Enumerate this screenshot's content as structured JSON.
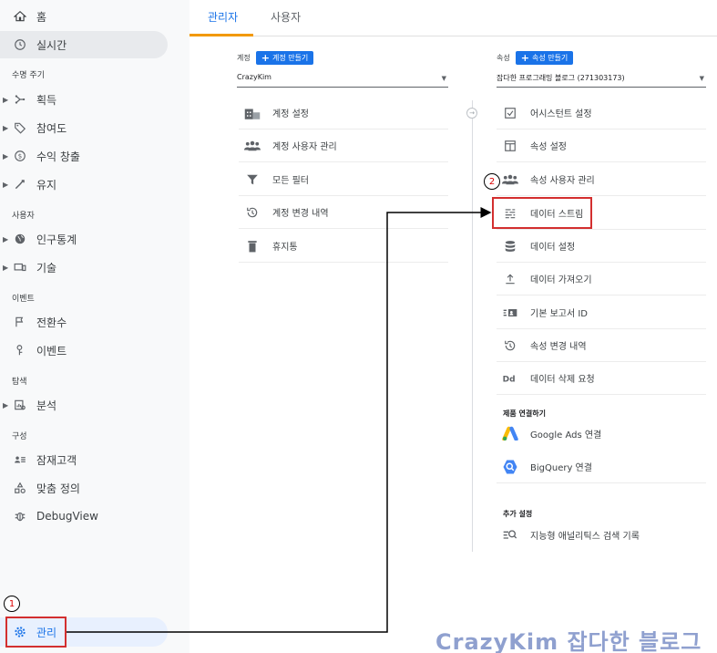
{
  "tabs": [
    {
      "label": "관리자",
      "active": true
    },
    {
      "label": "사용자",
      "active": false
    }
  ],
  "sidebar": {
    "top_items": [
      {
        "label": "홈",
        "icon": "home-icon"
      },
      {
        "label": "실시간",
        "icon": "clock-icon",
        "active": true
      }
    ],
    "sections": [
      {
        "title": "수명 주기",
        "items": [
          {
            "label": "획득",
            "icon": "acquisition-icon",
            "expandable": true
          },
          {
            "label": "참여도",
            "icon": "tag-icon",
            "expandable": true
          },
          {
            "label": "수익 창출",
            "icon": "dollar-icon",
            "expandable": true
          },
          {
            "label": "유지",
            "icon": "retention-icon",
            "expandable": true
          }
        ]
      },
      {
        "title": "사용자",
        "items": [
          {
            "label": "인구통계",
            "icon": "globe-icon",
            "expandable": true
          },
          {
            "label": "기술",
            "icon": "devices-icon",
            "expandable": true
          }
        ]
      },
      {
        "title": "이벤트",
        "items": [
          {
            "label": "전환수",
            "icon": "flag-icon"
          },
          {
            "label": "이벤트",
            "icon": "touch-icon"
          }
        ]
      },
      {
        "title": "탐색",
        "items": [
          {
            "label": "분석",
            "icon": "analysis-icon",
            "expandable": true
          }
        ]
      },
      {
        "title": "구성",
        "items": [
          {
            "label": "잠재고객",
            "icon": "audience-icon"
          },
          {
            "label": "맞춤 정의",
            "icon": "custom-icon"
          },
          {
            "label": "DebugView",
            "icon": "bug-icon"
          }
        ]
      }
    ],
    "admin_label": "관리"
  },
  "account_col": {
    "label": "계정",
    "create_label": "계정 만들기",
    "selected": "CrazyKim",
    "items": [
      {
        "label": "계정 설정",
        "icon": "building-icon"
      },
      {
        "label": "계정 사용자 관리",
        "icon": "people-icon"
      },
      {
        "label": "모든 필터",
        "icon": "filter-icon"
      },
      {
        "label": "계정 변경 내역",
        "icon": "history-icon"
      },
      {
        "label": "휴지통",
        "icon": "trash-icon"
      }
    ]
  },
  "property_col": {
    "label": "속성",
    "create_label": "속성 만들기",
    "selected": "잡다한 프로그래밍 블로그 (271303173)",
    "items": [
      {
        "label": "어시스턴트 설정",
        "icon": "checkbox-icon"
      },
      {
        "label": "속성 설정",
        "icon": "window-icon"
      },
      {
        "label": "속성 사용자 관리",
        "icon": "people-icon"
      },
      {
        "label": "데이터 스트림",
        "icon": "streams-icon"
      },
      {
        "label": "데이터 설정",
        "icon": "database-icon"
      },
      {
        "label": "데이터 가져오기",
        "icon": "upload-icon"
      },
      {
        "label": "기본 보고서 ID",
        "icon": "id-icon"
      },
      {
        "label": "속성 변경 내역",
        "icon": "history-icon"
      },
      {
        "label": "데이터 삭제 요청",
        "icon": "dd-icon"
      }
    ],
    "linking_title": "제품 연결하기",
    "linking_items": [
      {
        "label": "Google Ads 연결",
        "icon": "google-ads-icon"
      },
      {
        "label": "BigQuery 연결",
        "icon": "bigquery-icon"
      }
    ],
    "extra_title": "추가 설정",
    "extra_items": [
      {
        "label": "지능형 애널리틱스 검색 기록",
        "icon": "search-history-icon"
      }
    ]
  },
  "annotations": {
    "step1": "1",
    "step2": "2"
  },
  "watermark": "CrazyKim 잡다한 블로그",
  "colors": {
    "accent": "#1a73e8",
    "highlight": "#d32f2f",
    "tab_underline": "#f29900"
  }
}
